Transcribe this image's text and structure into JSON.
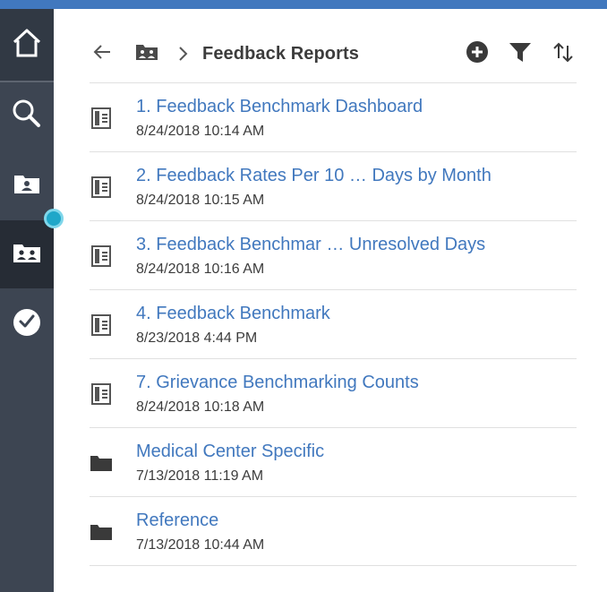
{
  "app": {
    "accent_color": "#4178be"
  },
  "sidebar": {
    "items": [
      {
        "name": "home",
        "icon": "home-icon"
      },
      {
        "name": "search",
        "icon": "search-icon"
      },
      {
        "name": "my-content",
        "icon": "user-folder-icon"
      },
      {
        "name": "team-content",
        "icon": "team-folder-icon",
        "active": true
      },
      {
        "name": "recent",
        "icon": "clock-icon"
      }
    ]
  },
  "header": {
    "title": "Feedback Reports",
    "back_icon": "arrow-left-icon",
    "folder_icon": "team-folder-icon",
    "separator_icon": "chevron-right-icon",
    "actions": [
      "add-icon",
      "filter-icon",
      "sort-icon"
    ]
  },
  "items": [
    {
      "name": "1. Feedback Benchmark Dashboard",
      "date": "8/24/2018 10:14 AM",
      "type": "report",
      "icon": "report-icon"
    },
    {
      "name": "2. Feedback Rates Per 10 … Days by Month",
      "date": "8/24/2018 10:15 AM",
      "type": "report",
      "icon": "report-icon"
    },
    {
      "name": "3. Feedback Benchmar … Unresolved Days",
      "date": "8/24/2018 10:16 AM",
      "type": "report",
      "icon": "report-icon"
    },
    {
      "name": "4. Feedback Benchmark",
      "date": "8/23/2018 4:44 PM",
      "type": "report",
      "icon": "report-icon"
    },
    {
      "name": "7. Grievance Benchmarking Counts",
      "date": "8/24/2018 10:18 AM",
      "type": "report",
      "icon": "report-icon"
    },
    {
      "name": "Medical Center Specific",
      "date": "7/13/2018 11:19 AM",
      "type": "folder",
      "icon": "folder-icon"
    },
    {
      "name": "Reference",
      "date": "7/13/2018 10:44 AM",
      "type": "folder",
      "icon": "folder-icon"
    }
  ]
}
